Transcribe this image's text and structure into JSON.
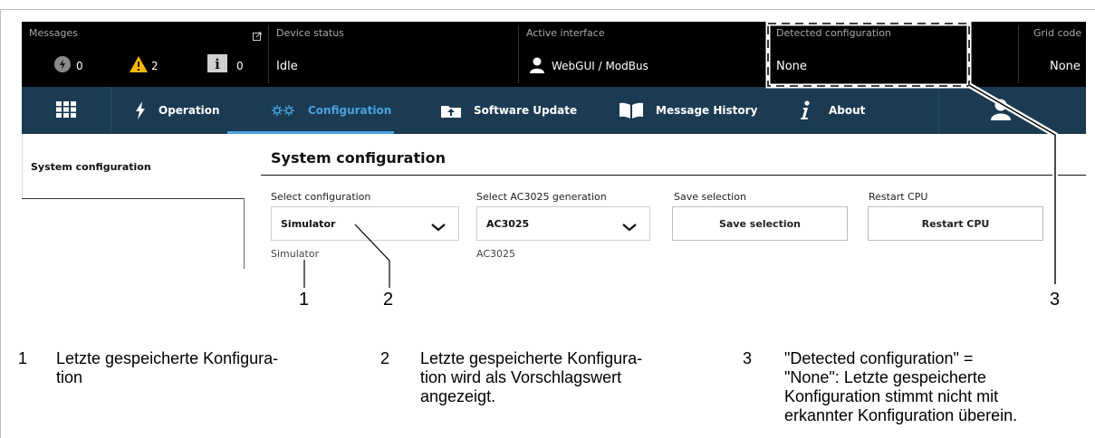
{
  "statusbar": {
    "messages": {
      "label": "Messages",
      "error_count": "0",
      "warning_count": "2",
      "info_count": "0"
    },
    "device_status": {
      "label": "Device status",
      "value": "Idle"
    },
    "active_interface": {
      "label": "Active interface",
      "value": "WebGUI / ModBus"
    },
    "detected_configuration": {
      "label": "Detected configuration",
      "value": "None"
    },
    "grid_code": {
      "label": "Grid code",
      "value": "None"
    }
  },
  "nav": {
    "operation": "Operation",
    "configuration": "Configuration",
    "software_update": "Software Update",
    "message_history": "Message History",
    "about": "About"
  },
  "sidebar": {
    "items": [
      {
        "label": "System configuration"
      }
    ]
  },
  "main": {
    "title": "System configuration",
    "select_configuration": {
      "label": "Select configuration",
      "value": "Simulator",
      "hint": "Simulator"
    },
    "select_generation": {
      "label": "Select AC3025 generation",
      "value": "AC3025",
      "hint": "AC3025"
    },
    "save_selection": {
      "label": "Save selection",
      "button": "Save selection"
    },
    "restart_cpu": {
      "label": "Restart CPU",
      "button": "Restart CPU"
    }
  },
  "callouts": {
    "markers": [
      "1",
      "2",
      "3"
    ],
    "legend": [
      {
        "num": "1",
        "text": [
          "Letzte gespeicherte Konfigura-",
          "tion"
        ]
      },
      {
        "num": "2",
        "text": [
          "Letzte gespeicherte Konfigura-",
          "tion wird als Vorschlagswert",
          "angezeigt."
        ]
      },
      {
        "num": "3",
        "text": [
          "\"Detected configuration\" =",
          "\"None\": Letzte gespeicherte",
          "Konfiguration stimmt nicht mit",
          "erkannter Konfiguration überein."
        ]
      }
    ]
  },
  "colors": {
    "navbar": "#1b3b53",
    "accent": "#4aa3df",
    "statusbar": "#000000",
    "warning": "#f5b800"
  }
}
